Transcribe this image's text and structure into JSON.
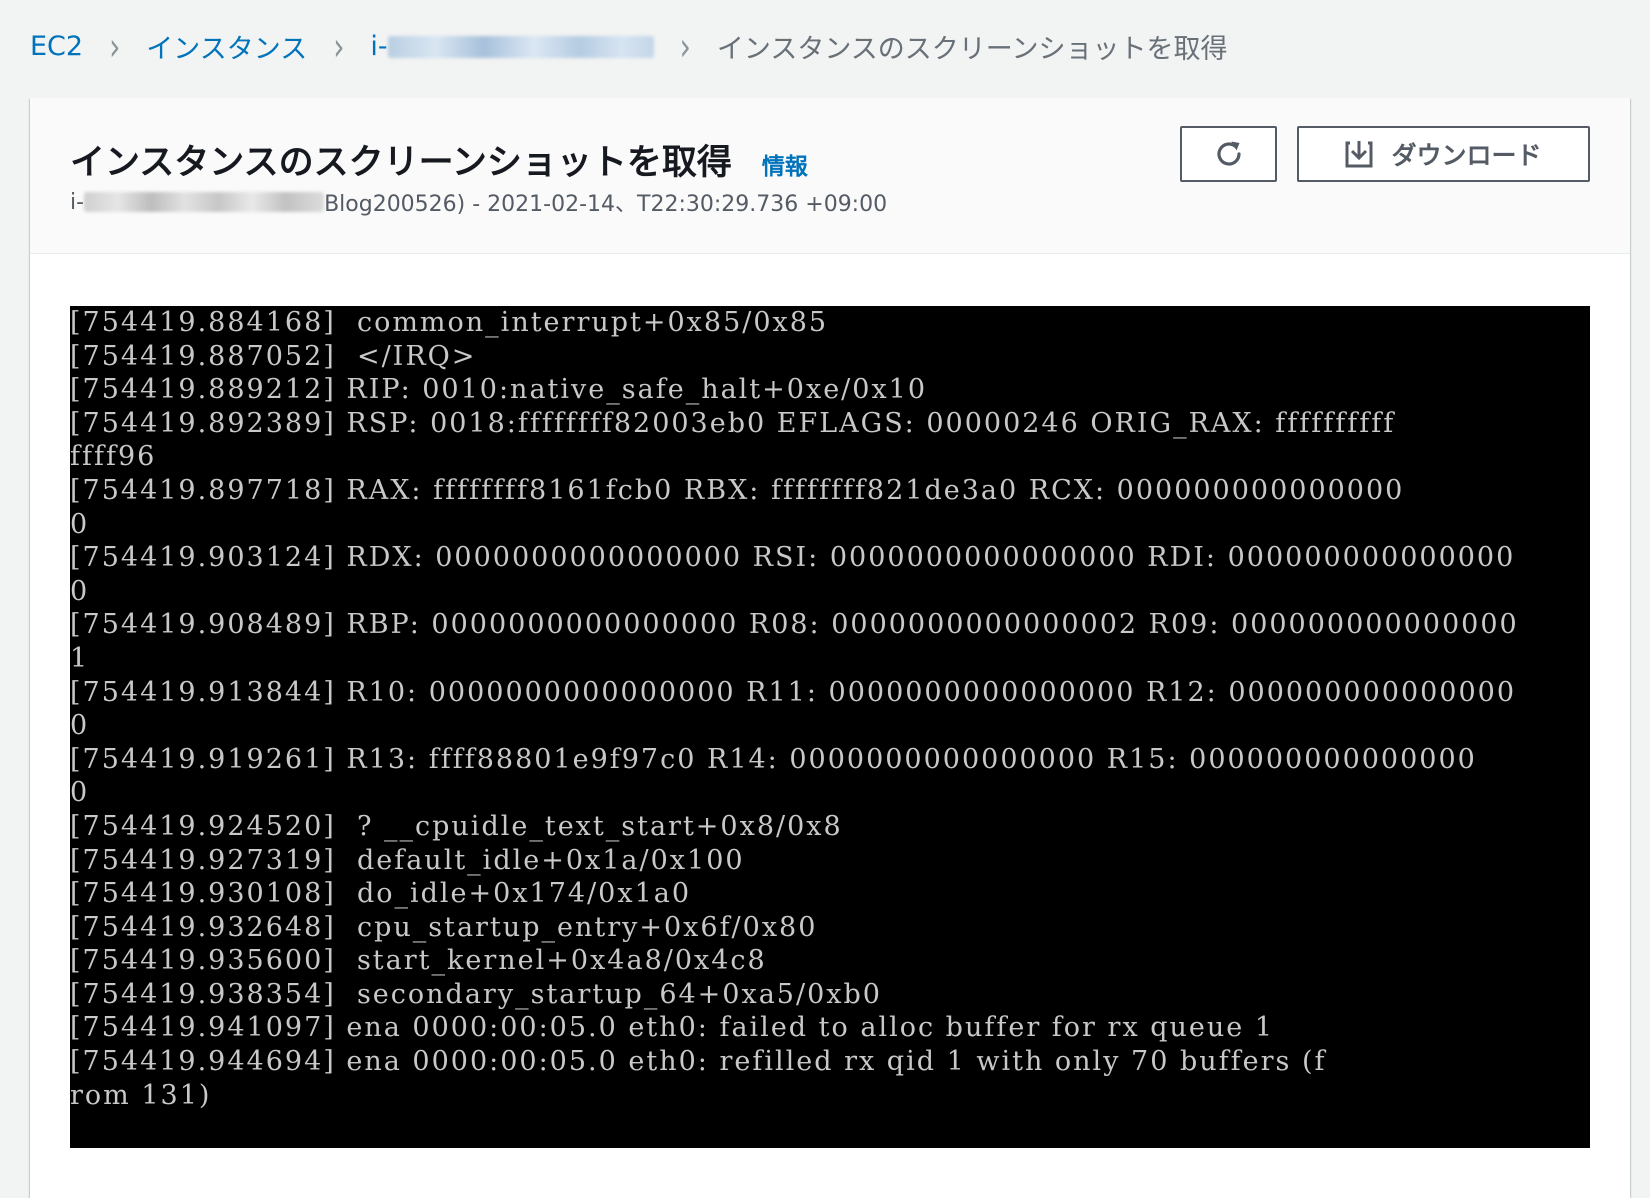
{
  "breadcrumb": {
    "items": [
      {
        "label": "EC2"
      },
      {
        "label": "インスタンス"
      },
      {
        "label": "i-"
      },
      {
        "label": "インスタンスのスクリーンショットを取得"
      }
    ],
    "separator": "›"
  },
  "panel": {
    "title": "インスタンスのスクリーンショットを取得",
    "info_label": "情報",
    "subtitle_prefix": "i-",
    "subtitle_suffix": "Blog200526) - 2021-02-14、T22:30:29.736 +09:00"
  },
  "actions": {
    "refresh_icon": "refresh-icon",
    "download_icon": "download-icon",
    "download_label": "ダウンロード"
  },
  "console": {
    "lines": [
      "[754419.884168]  common_interrupt+0x85/0x85",
      "[754419.887052]  </IRQ>",
      "[754419.889212] RIP: 0010:native_safe_halt+0xe/0x10",
      "[754419.892389] RSP: 0018:ffffffff82003eb0 EFLAGS: 00000246 ORIG_RAX: ffffffffff",
      "ffff96",
      "[754419.897718] RAX: ffffffff8161fcb0 RBX: ffffffff821de3a0 RCX: 000000000000000",
      "0",
      "[754419.903124] RDX: 0000000000000000 RSI: 0000000000000000 RDI: 000000000000000",
      "0",
      "[754419.908489] RBP: 0000000000000000 R08: 0000000000000002 R09: 000000000000000",
      "1",
      "[754419.913844] R10: 0000000000000000 R11: 0000000000000000 R12: 000000000000000",
      "0",
      "[754419.919261] R13: ffff88801e9f97c0 R14: 0000000000000000 R15: 000000000000000",
      "0",
      "[754419.924520]  ? __cpuidle_text_start+0x8/0x8",
      "[754419.927319]  default_idle+0x1a/0x100",
      "[754419.930108]  do_idle+0x174/0x1a0",
      "[754419.932648]  cpu_startup_entry+0x6f/0x80",
      "[754419.935600]  start_kernel+0x4a8/0x4c8",
      "[754419.938354]  secondary_startup_64+0xa5/0xb0",
      "[754419.941097] ena 0000:00:05.0 eth0: failed to alloc buffer for rx queue 1",
      "[754419.944694] ena 0000:00:05.0 eth0: refilled rx qid 1 with only 70 buffers (f",
      "rom 131)"
    ]
  },
  "colors": {
    "link": "#0073bb",
    "page_background": "#f2f3f3",
    "console_background": "#000000",
    "console_text": "#c8c8c8"
  }
}
